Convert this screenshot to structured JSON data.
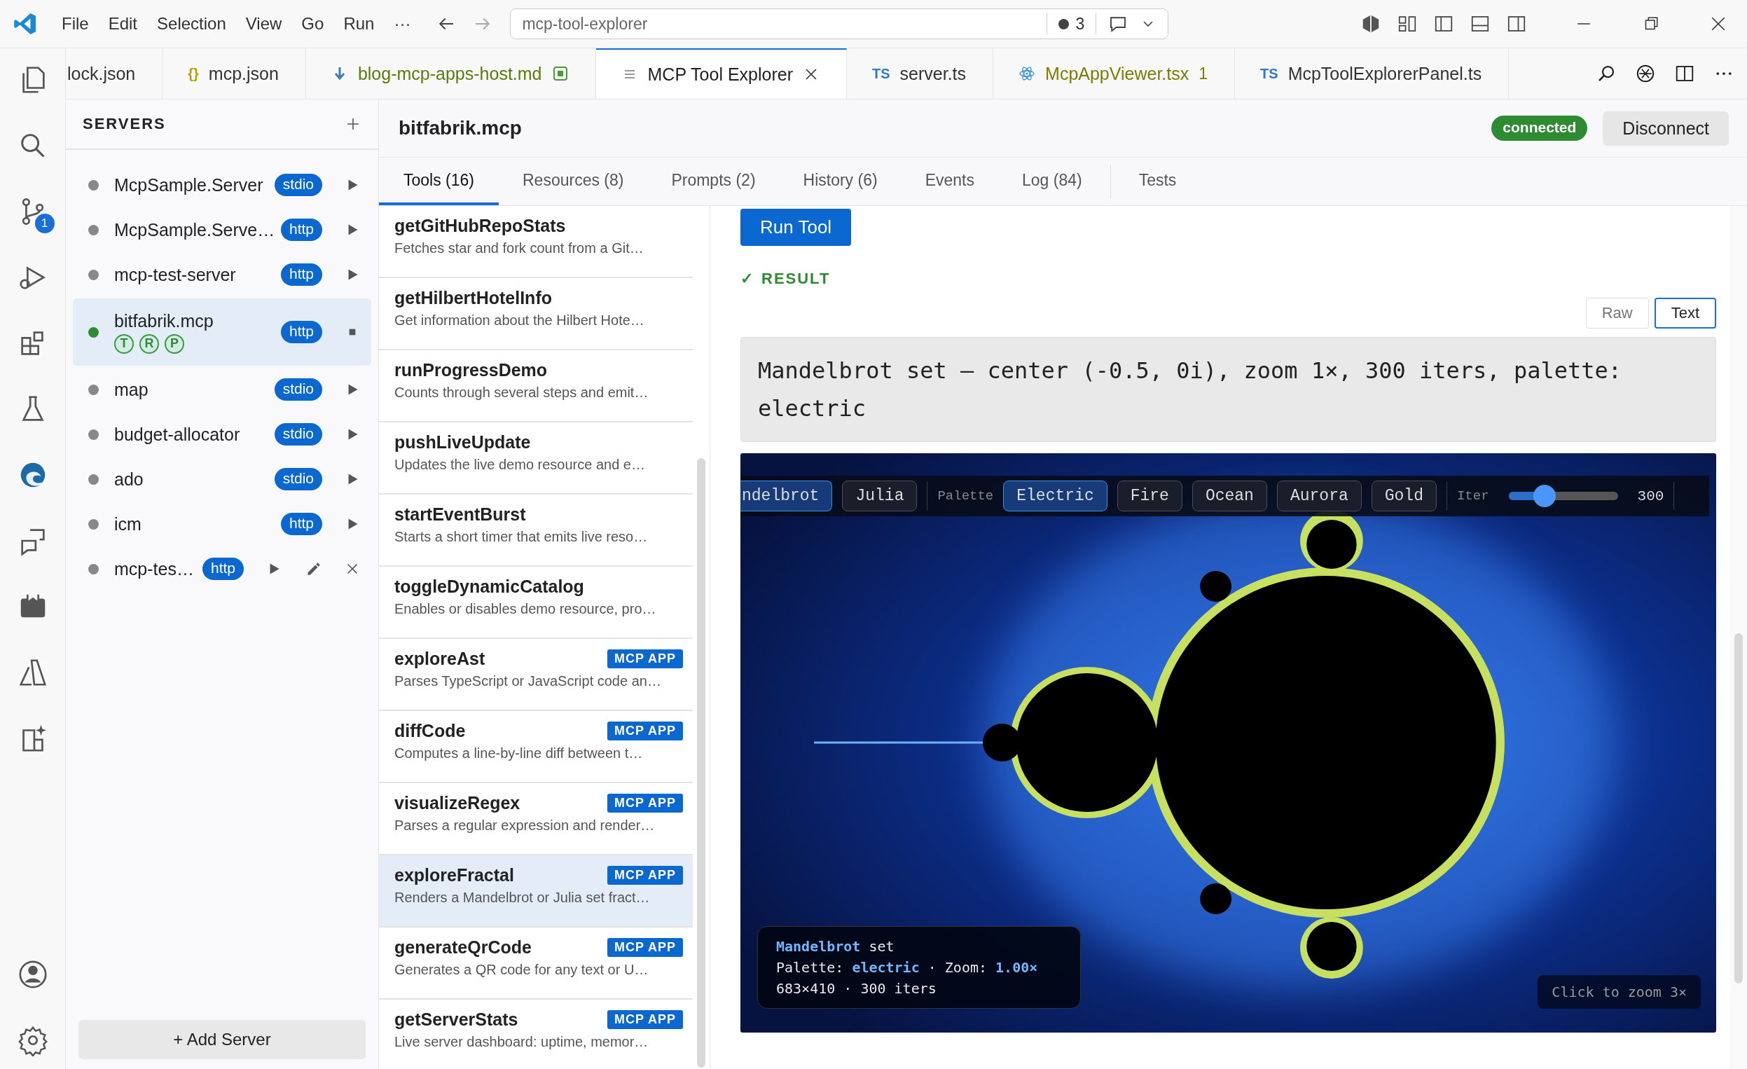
{
  "menu": [
    "File",
    "Edit",
    "Selection",
    "View",
    "Go",
    "Run",
    "···"
  ],
  "command_center": {
    "value": "mcp-tool-explorer",
    "count": "3"
  },
  "activity_bar": {
    "scm_badge": "1"
  },
  "editor_tabs": [
    {
      "label": "lock.json",
      "kind": "plain",
      "selected": false,
      "color": "#333333"
    },
    {
      "label": "mcp.json",
      "kind": "json",
      "icon_text": "{}",
      "selected": false,
      "color": "#333333"
    },
    {
      "label": "blog-mcp-apps-host.md",
      "kind": "markdown",
      "selected": false,
      "color": "#587c0c"
    },
    {
      "label": "MCP Tool Explorer",
      "kind": "panel",
      "selected": true,
      "color": "#1f1f1f"
    },
    {
      "label": "server.ts",
      "kind": "typescript",
      "icon_text": "TS",
      "selected": false,
      "color": "#333333"
    },
    {
      "label": "McpAppViewer.tsx",
      "kind": "react",
      "selected": false,
      "color": "#7a7d00",
      "badge": "1"
    },
    {
      "label": "McpToolExplorerPanel.ts",
      "kind": "typescript",
      "icon_text": "TS",
      "selected": false,
      "color": "#333333"
    }
  ],
  "servers": {
    "title": "SERVERS",
    "items": [
      {
        "name": "McpSample.Server",
        "transport": "stdio",
        "connected": false,
        "selected": false,
        "editable": false
      },
      {
        "name": "McpSample.Serve…",
        "transport": "http",
        "connected": false,
        "selected": false,
        "editable": false
      },
      {
        "name": "mcp-test-server",
        "transport": "http",
        "connected": false,
        "selected": false,
        "editable": false
      },
      {
        "name": "bitfabrik.mcp",
        "transport": "http",
        "connected": true,
        "selected": true,
        "editable": false,
        "capabilities": [
          "T",
          "R",
          "P"
        ]
      },
      {
        "name": "map",
        "transport": "stdio",
        "connected": false,
        "selected": false,
        "editable": false
      },
      {
        "name": "budget-allocator",
        "transport": "stdio",
        "connected": false,
        "selected": false,
        "editable": false
      },
      {
        "name": "ado",
        "transport": "stdio",
        "connected": false,
        "selected": false,
        "editable": false
      },
      {
        "name": "icm",
        "transport": "http",
        "connected": false,
        "selected": false,
        "editable": false
      },
      {
        "name": "mcp-tes…",
        "transport": "http",
        "connected": false,
        "selected": false,
        "editable": true
      }
    ],
    "add_button": "+ Add Server"
  },
  "header": {
    "name": "bitfabrik.mcp",
    "status": "connected",
    "button": "Disconnect"
  },
  "tabs": [
    {
      "label": "Tools (16)",
      "selected": true
    },
    {
      "label": "Resources (8)",
      "selected": false
    },
    {
      "label": "Prompts (2)",
      "selected": false
    },
    {
      "label": "History (6)",
      "selected": false
    },
    {
      "label": "Events",
      "selected": false
    },
    {
      "label": "Log (84)",
      "selected": false
    },
    {
      "label": "Tests",
      "selected": false
    }
  ],
  "tools": [
    {
      "name": "getGitHubRepoStats",
      "description": "Fetches star and fork count from a Git…",
      "selected": false
    },
    {
      "name": "getHilbertHotelInfo",
      "description": "Get information about the Hilbert Hote…",
      "selected": false
    },
    {
      "name": "runProgressDemo",
      "description": "Counts through several steps and emit…",
      "selected": false
    },
    {
      "name": "pushLiveUpdate",
      "description": "Updates the live demo resource and e…",
      "selected": false
    },
    {
      "name": "startEventBurst",
      "description": "Starts a short timer that emits live reso…",
      "selected": false
    },
    {
      "name": "toggleDynamicCatalog",
      "description": "Enables or disables demo resource, pro…",
      "selected": false
    },
    {
      "name": "exploreAst",
      "description": "Parses TypeScript or JavaScript code an…",
      "selected": false,
      "badge": "MCP APP"
    },
    {
      "name": "diffCode",
      "description": "Computes a line-by-line diff between t…",
      "selected": false,
      "badge": "MCP APP"
    },
    {
      "name": "visualizeRegex",
      "description": "Parses a regular expression and render…",
      "selected": false,
      "badge": "MCP APP"
    },
    {
      "name": "exploreFractal",
      "description": "Renders a Mandelbrot or Julia set fract…",
      "selected": true,
      "badge": "MCP APP"
    },
    {
      "name": "generateQrCode",
      "description": "Generates a QR code for any text or U…",
      "selected": false,
      "badge": "MCP APP"
    },
    {
      "name": "getServerStats",
      "description": "Live server dashboard: uptime, memor…",
      "selected": false,
      "badge": "MCP APP"
    }
  ],
  "run_button": "Run Tool",
  "result": {
    "mark": "✓",
    "label": "RESULT",
    "views": [
      {
        "label": "Raw",
        "selected": false
      },
      {
        "label": "Text",
        "selected": true
      }
    ],
    "text": "Mandelbrot set — center (-0.5, 0i), zoom 1×, 300 iters, palette: electric"
  },
  "fractal_app": {
    "modes": [
      {
        "label": "ndelbrot",
        "selected": true
      },
      {
        "label": "Julia",
        "selected": false
      }
    ],
    "palette_label": "Palette",
    "palettes": [
      {
        "label": "Electric",
        "selected": true
      },
      {
        "label": "Fire",
        "selected": false
      },
      {
        "label": "Ocean",
        "selected": false
      },
      {
        "label": "Aurora",
        "selected": false
      },
      {
        "label": "Gold",
        "selected": false
      }
    ],
    "iter_label": "Iter",
    "iter": {
      "level": 0.3,
      "value": "300"
    },
    "info": [
      "**Mandelbrot** set",
      "Palette: **electric** · Zoom: **1.00×**",
      "683×410 · 300 iters"
    ],
    "hint": "Click to zoom 3×"
  }
}
